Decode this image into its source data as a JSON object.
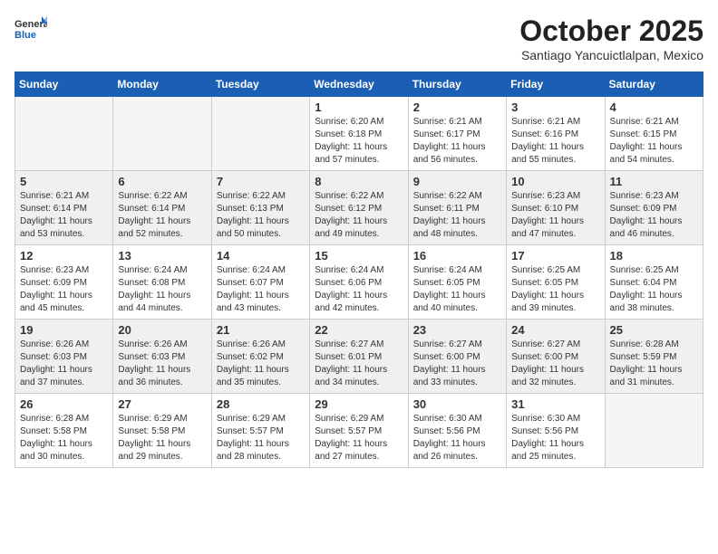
{
  "header": {
    "logo": {
      "general": "General",
      "blue": "Blue"
    },
    "title": "October 2025",
    "location": "Santiago Yancuictlalpan, Mexico"
  },
  "weekdays": [
    "Sunday",
    "Monday",
    "Tuesday",
    "Wednesday",
    "Thursday",
    "Friday",
    "Saturday"
  ],
  "weeks": [
    [
      {
        "day": null,
        "info": null
      },
      {
        "day": null,
        "info": null
      },
      {
        "day": null,
        "info": null
      },
      {
        "day": "1",
        "info": "Sunrise: 6:20 AM\nSunset: 6:18 PM\nDaylight: 11 hours and 57 minutes."
      },
      {
        "day": "2",
        "info": "Sunrise: 6:21 AM\nSunset: 6:17 PM\nDaylight: 11 hours and 56 minutes."
      },
      {
        "day": "3",
        "info": "Sunrise: 6:21 AM\nSunset: 6:16 PM\nDaylight: 11 hours and 55 minutes."
      },
      {
        "day": "4",
        "info": "Sunrise: 6:21 AM\nSunset: 6:15 PM\nDaylight: 11 hours and 54 minutes."
      }
    ],
    [
      {
        "day": "5",
        "info": "Sunrise: 6:21 AM\nSunset: 6:14 PM\nDaylight: 11 hours and 53 minutes."
      },
      {
        "day": "6",
        "info": "Sunrise: 6:22 AM\nSunset: 6:14 PM\nDaylight: 11 hours and 52 minutes."
      },
      {
        "day": "7",
        "info": "Sunrise: 6:22 AM\nSunset: 6:13 PM\nDaylight: 11 hours and 50 minutes."
      },
      {
        "day": "8",
        "info": "Sunrise: 6:22 AM\nSunset: 6:12 PM\nDaylight: 11 hours and 49 minutes."
      },
      {
        "day": "9",
        "info": "Sunrise: 6:22 AM\nSunset: 6:11 PM\nDaylight: 11 hours and 48 minutes."
      },
      {
        "day": "10",
        "info": "Sunrise: 6:23 AM\nSunset: 6:10 PM\nDaylight: 11 hours and 47 minutes."
      },
      {
        "day": "11",
        "info": "Sunrise: 6:23 AM\nSunset: 6:09 PM\nDaylight: 11 hours and 46 minutes."
      }
    ],
    [
      {
        "day": "12",
        "info": "Sunrise: 6:23 AM\nSunset: 6:09 PM\nDaylight: 11 hours and 45 minutes."
      },
      {
        "day": "13",
        "info": "Sunrise: 6:24 AM\nSunset: 6:08 PM\nDaylight: 11 hours and 44 minutes."
      },
      {
        "day": "14",
        "info": "Sunrise: 6:24 AM\nSunset: 6:07 PM\nDaylight: 11 hours and 43 minutes."
      },
      {
        "day": "15",
        "info": "Sunrise: 6:24 AM\nSunset: 6:06 PM\nDaylight: 11 hours and 42 minutes."
      },
      {
        "day": "16",
        "info": "Sunrise: 6:24 AM\nSunset: 6:05 PM\nDaylight: 11 hours and 40 minutes."
      },
      {
        "day": "17",
        "info": "Sunrise: 6:25 AM\nSunset: 6:05 PM\nDaylight: 11 hours and 39 minutes."
      },
      {
        "day": "18",
        "info": "Sunrise: 6:25 AM\nSunset: 6:04 PM\nDaylight: 11 hours and 38 minutes."
      }
    ],
    [
      {
        "day": "19",
        "info": "Sunrise: 6:26 AM\nSunset: 6:03 PM\nDaylight: 11 hours and 37 minutes."
      },
      {
        "day": "20",
        "info": "Sunrise: 6:26 AM\nSunset: 6:03 PM\nDaylight: 11 hours and 36 minutes."
      },
      {
        "day": "21",
        "info": "Sunrise: 6:26 AM\nSunset: 6:02 PM\nDaylight: 11 hours and 35 minutes."
      },
      {
        "day": "22",
        "info": "Sunrise: 6:27 AM\nSunset: 6:01 PM\nDaylight: 11 hours and 34 minutes."
      },
      {
        "day": "23",
        "info": "Sunrise: 6:27 AM\nSunset: 6:00 PM\nDaylight: 11 hours and 33 minutes."
      },
      {
        "day": "24",
        "info": "Sunrise: 6:27 AM\nSunset: 6:00 PM\nDaylight: 11 hours and 32 minutes."
      },
      {
        "day": "25",
        "info": "Sunrise: 6:28 AM\nSunset: 5:59 PM\nDaylight: 11 hours and 31 minutes."
      }
    ],
    [
      {
        "day": "26",
        "info": "Sunrise: 6:28 AM\nSunset: 5:58 PM\nDaylight: 11 hours and 30 minutes."
      },
      {
        "day": "27",
        "info": "Sunrise: 6:29 AM\nSunset: 5:58 PM\nDaylight: 11 hours and 29 minutes."
      },
      {
        "day": "28",
        "info": "Sunrise: 6:29 AM\nSunset: 5:57 PM\nDaylight: 11 hours and 28 minutes."
      },
      {
        "day": "29",
        "info": "Sunrise: 6:29 AM\nSunset: 5:57 PM\nDaylight: 11 hours and 27 minutes."
      },
      {
        "day": "30",
        "info": "Sunrise: 6:30 AM\nSunset: 5:56 PM\nDaylight: 11 hours and 26 minutes."
      },
      {
        "day": "31",
        "info": "Sunrise: 6:30 AM\nSunset: 5:56 PM\nDaylight: 11 hours and 25 minutes."
      },
      {
        "day": null,
        "info": null
      }
    ]
  ]
}
